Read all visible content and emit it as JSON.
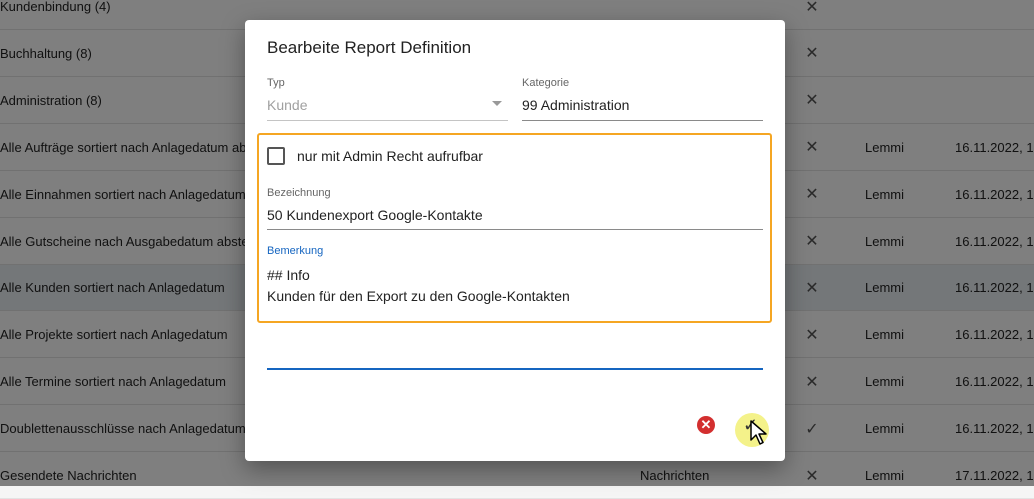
{
  "table": {
    "rows": [
      {
        "name": "Kundenbindung (4)",
        "category": "",
        "icon": "✕",
        "user": "",
        "date": "",
        "highlight": false
      },
      {
        "name": "Buchhaltung (8)",
        "category": "",
        "icon": "✕",
        "user": "",
        "date": "",
        "highlight": false
      },
      {
        "name": "Administration (8)",
        "category": "",
        "icon": "✕",
        "user": "",
        "date": "",
        "highlight": false
      },
      {
        "name": "Alle Aufträge sortiert nach Anlagedatum abs",
        "category": "",
        "icon": "✕",
        "user": "Lemmi",
        "date": "16.11.2022, 1",
        "highlight": false
      },
      {
        "name": "Alle Einnahmen sortiert nach Anlagedatum",
        "category": "",
        "icon": "✕",
        "user": "Lemmi",
        "date": "16.11.2022, 1",
        "highlight": false
      },
      {
        "name": "Alle Gutscheine nach Ausgabedatum abstei",
        "category": "",
        "icon": "✕",
        "user": "Lemmi",
        "date": "16.11.2022, 1",
        "highlight": false
      },
      {
        "name": "Alle Kunden sortiert nach Anlagedatum",
        "category": "",
        "icon": "✕",
        "user": "Lemmi",
        "date": "16.11.2022, 1",
        "highlight": true
      },
      {
        "name": "Alle Projekte sortiert nach Anlagedatum",
        "category": "",
        "icon": "✕",
        "user": "Lemmi",
        "date": "16.11.2022, 1",
        "highlight": false
      },
      {
        "name": "Alle Termine sortiert nach Anlagedatum",
        "category": "",
        "icon": "✕",
        "user": "Lemmi",
        "date": "16.11.2022, 1",
        "highlight": false
      },
      {
        "name": "Doublettenausschlüsse nach Anlagedatum",
        "category": "",
        "icon": "✓",
        "user": "Lemmi",
        "date": "16.11.2022, 1",
        "highlight": false
      },
      {
        "name": "Gesendete Nachrichten",
        "category": "Nachrichten",
        "icon": "✕",
        "user": "Lemmi",
        "date": "17.11.2022, 1",
        "highlight": false
      }
    ]
  },
  "dialog": {
    "title": "Bearbeite Report Definition",
    "typ": {
      "label": "Typ",
      "value": "Kunde"
    },
    "kategorie": {
      "label": "Kategorie",
      "value": "99 Administration"
    },
    "admin_checkbox": {
      "label": "nur mit Admin Recht aufrufbar",
      "checked": false
    },
    "bezeichnung": {
      "label": "Bezeichnung",
      "value": "50 Kundenexport Google-Kontakte"
    },
    "bemerkung": {
      "label": "Bemerkung",
      "value": "## Info\nKunden für den Export zu den Google-Kontakten"
    },
    "cancel_icon": "close-circle-icon",
    "confirm_icon": "check-icon"
  },
  "colors": {
    "highlight_border": "#f5a623",
    "focus_blue": "#1565c0",
    "cancel_red": "#d32f2f",
    "cursor_highlight": "#f4f28a"
  }
}
